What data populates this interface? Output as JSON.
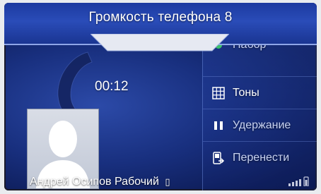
{
  "volume_popup": {
    "text": "Громкость телефона 8"
  },
  "call": {
    "timer": "00:12",
    "caller_first": "Андрей",
    "caller_last": "Осипов",
    "number_type": "Рабочий",
    "phone_glyph": "▯"
  },
  "menu": {
    "items": [
      {
        "label": "Набор",
        "icon": "keypad-dial-icon"
      },
      {
        "label": "Тоны",
        "icon": "keypad-grid-icon"
      },
      {
        "label": "Удержание",
        "icon": "pause-icon"
      },
      {
        "label": "Перенести",
        "icon": "transfer-phone-icon"
      }
    ]
  },
  "colors": {
    "background": "#182f7e",
    "accent": "#2a4cb8",
    "text": "#ffffff"
  }
}
